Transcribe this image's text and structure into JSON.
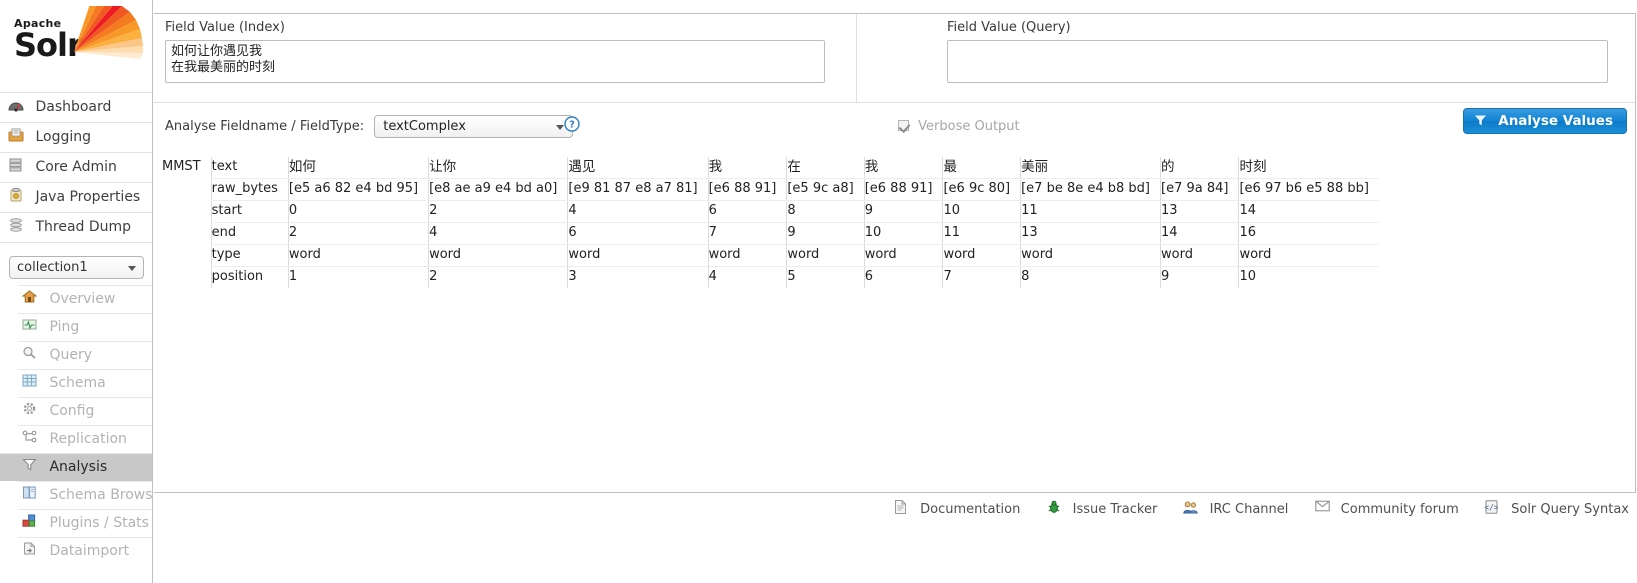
{
  "brand": {
    "apache": "Apache",
    "solr": "Solr"
  },
  "sidebar": {
    "top_items": [
      {
        "label": "Dashboard",
        "icon": "dashboard-icon"
      },
      {
        "label": "Logging",
        "icon": "logging-icon"
      },
      {
        "label": "Core Admin",
        "icon": "core-admin-icon"
      },
      {
        "label": "Java Properties",
        "icon": "java-properties-icon"
      },
      {
        "label": "Thread Dump",
        "icon": "thread-dump-icon"
      }
    ],
    "collection_selected": "collection1",
    "core_items": [
      {
        "label": "Overview",
        "icon": "home-icon",
        "active": false
      },
      {
        "label": "Ping",
        "icon": "ping-icon",
        "active": false
      },
      {
        "label": "Query",
        "icon": "magnifier-icon",
        "active": false
      },
      {
        "label": "Schema",
        "icon": "schema-grid-icon",
        "active": false
      },
      {
        "label": "Config",
        "icon": "gear-icon",
        "active": false
      },
      {
        "label": "Replication",
        "icon": "replication-icon",
        "active": false
      },
      {
        "label": "Analysis",
        "icon": "funnel-icon",
        "active": true
      },
      {
        "label": "Schema Browser",
        "icon": "book-icon",
        "active": false
      },
      {
        "label": "Plugins / Stats",
        "icon": "plugins-icon",
        "active": false
      },
      {
        "label": "Dataimport",
        "icon": "dataimport-icon",
        "active": false
      }
    ]
  },
  "form": {
    "index_label": "Field Value (Index)",
    "index_value": "如何让你遇见我\n在我最美丽的时刻",
    "index_placeholder": "",
    "query_label": "Field Value (Query)",
    "query_value": "",
    "query_placeholder": "",
    "analyse_fieldname_label": "Analyse Fieldname / FieldType:",
    "fieldtype_selected": "textComplex",
    "help_icon": "help-circle-icon",
    "verbose_label": "Verbose Output",
    "verbose_checked": true,
    "analyse_button_label": "Analyse Values",
    "analyse_button_icon": "funnel-icon",
    "accent_color": "#1184d4"
  },
  "analysis": {
    "analyzer": "MMST",
    "row_labels": [
      "text",
      "raw_bytes",
      "start",
      "end",
      "type",
      "position"
    ],
    "tokens": [
      {
        "text": "如何",
        "raw_bytes": "[e5 a6 82 e4 bd 95]",
        "start": "0",
        "end": "2",
        "type": "word",
        "position": "1"
      },
      {
        "text": "让你",
        "raw_bytes": "[e8 ae a9 e4 bd a0]",
        "start": "2",
        "end": "4",
        "type": "word",
        "position": "2"
      },
      {
        "text": "遇见",
        "raw_bytes": "[e9 81 87 e8 a7 81]",
        "start": "4",
        "end": "6",
        "type": "word",
        "position": "3"
      },
      {
        "text": "我",
        "raw_bytes": "[e6 88 91]",
        "start": "6",
        "end": "7",
        "type": "word",
        "position": "4"
      },
      {
        "text": "在",
        "raw_bytes": "[e5 9c a8]",
        "start": "8",
        "end": "9",
        "type": "word",
        "position": "5"
      },
      {
        "text": "我",
        "raw_bytes": "[e6 88 91]",
        "start": "9",
        "end": "10",
        "type": "word",
        "position": "6"
      },
      {
        "text": "最",
        "raw_bytes": "[e6 9c 80]",
        "start": "10",
        "end": "11",
        "type": "word",
        "position": "7"
      },
      {
        "text": "美丽",
        "raw_bytes": "[e7 be 8e e4 b8 bd]",
        "start": "11",
        "end": "13",
        "type": "word",
        "position": "8"
      },
      {
        "text": "的",
        "raw_bytes": "[e7 9a 84]",
        "start": "13",
        "end": "14",
        "type": "word",
        "position": "9"
      },
      {
        "text": "时刻",
        "raw_bytes": "[e6 97 b6 e5 88 bb]",
        "start": "14",
        "end": "16",
        "type": "word",
        "position": "10"
      }
    ]
  },
  "footer": {
    "links": [
      {
        "label": "Documentation",
        "icon": "document-icon"
      },
      {
        "label": "Issue Tracker",
        "icon": "bug-icon"
      },
      {
        "label": "IRC Channel",
        "icon": "people-icon"
      },
      {
        "label": "Community forum",
        "icon": "envelope-icon"
      },
      {
        "label": "Solr Query Syntax",
        "icon": "code-icon"
      }
    ]
  }
}
